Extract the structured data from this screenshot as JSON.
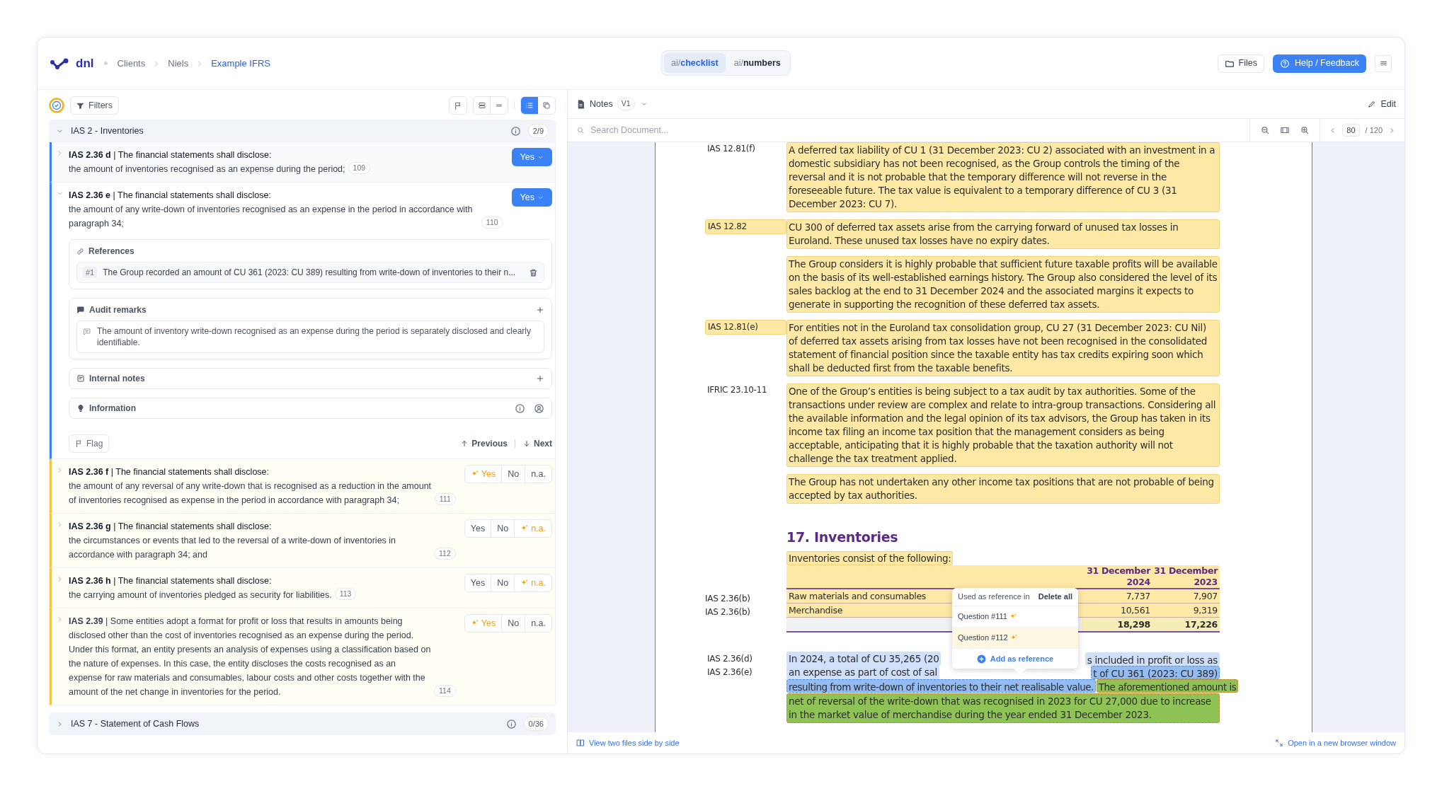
{
  "header": {
    "logo": "dnl",
    "breadcrumbs": [
      {
        "label": "Clients",
        "current": false
      },
      {
        "label": "Niels",
        "current": false
      },
      {
        "label": "Example IFRS",
        "current": true
      }
    ],
    "mode_tabs": [
      {
        "prefix": "ai/",
        "label": "checklist",
        "selected": true
      },
      {
        "prefix": "ai/",
        "label": "numbers",
        "selected": false
      }
    ],
    "files_button": "Files",
    "help_button": "Help / Feedback"
  },
  "checklist": {
    "filters_button": "Filters",
    "view_modes": [
      {
        "kind": "list",
        "selected": true
      },
      {
        "kind": "cards",
        "selected": false
      }
    ],
    "groups": [
      {
        "title": "IAS 2 - Inventories",
        "count": "2/9",
        "expanded": true,
        "items": [
          {
            "title": "**IAS 2.36 d** | The financial statements shall disclose:",
            "body": "the amount of inventories recognised as an expense during the period;",
            "number": "109",
            "expanded": false,
            "answer": {
              "kind": "confirmed",
              "label": "Yes"
            }
          },
          {
            "title": "**IAS 2.36 e** | The financial statements shall disclose:",
            "body": "the amount of any write-down of inventories recognised as an expense in the period in accordance with paragraph 34;",
            "number": "110",
            "expanded": true,
            "answer": {
              "kind": "confirmed",
              "label": "Yes"
            },
            "details": {
              "references": {
                "title": "References",
                "items": [
                  {
                    "index": "#1",
                    "text": "The Group recorded an amount of CU 361 (2023: CU 389) resulting from write-down of inventories to their n..."
                  }
                ]
              },
              "audit_remarks": {
                "title": "Audit remarks",
                "items": [
                  "The amount of inventory write-down recognised as an expense during the period is separately disclosed and clearly identifiable."
                ]
              },
              "internal_notes": {
                "title": "Internal notes"
              },
              "information": {
                "title": "Information"
              },
              "flag_button": "Flag",
              "previous_button": "Previous",
              "next_button": "Next"
            }
          },
          {
            "title": "**IAS 2.36 f** | The financial statements shall disclose:",
            "body": "the amount of any reversal of any write-down that is recognised as a reduction in the amount of inventories recognised as expense in the period in accordance with paragraph 34;",
            "number": "111",
            "expanded": false,
            "answer": {
              "kind": "suggested",
              "options": [
                {
                  "label": "Yes",
                  "suggested": true
                },
                {
                  "label": "No",
                  "suggested": false
                },
                {
                  "label": "n.a.",
                  "suggested": false
                }
              ]
            }
          },
          {
            "title": "**IAS 2.36 g** | The financial statements shall disclose:",
            "body": "the circumstances or events that led to the reversal of a write-down of inventories in accordance with paragraph 34; and",
            "number": "112",
            "expanded": false,
            "answer": {
              "kind": "suggested",
              "options": [
                {
                  "label": "Yes",
                  "suggested": false
                },
                {
                  "label": "No",
                  "suggested": false
                },
                {
                  "label": "n.a.",
                  "suggested": true
                }
              ]
            }
          },
          {
            "title": "**IAS 2.36 h** | The financial statements shall disclose:",
            "body": "the carrying amount of inventories pledged as security for liabilities.",
            "number": "113",
            "expanded": false,
            "answer": {
              "kind": "suggested",
              "options": [
                {
                  "label": "Yes",
                  "suggested": false
                },
                {
                  "label": "No",
                  "suggested": false
                },
                {
                  "label": "n.a.",
                  "suggested": true
                }
              ]
            }
          },
          {
            "title": "**IAS 2.39** | Some entities adopt a format for profit or loss that results in amounts being disclosed other than the cost of inventories recognised as an expense during the period. Under this format, an entity presents an analysis of expenses using a classification based on the nature of expenses. In this case, the entity discloses the costs recognised as an expense for raw materials and consumables, labour costs and other costs together with the amount of the net change in inventories for the period.",
            "number": "114",
            "expanded": false,
            "answer": {
              "kind": "suggested",
              "options": [
                {
                  "label": "Yes",
                  "suggested": true
                },
                {
                  "label": "No",
                  "suggested": false
                },
                {
                  "label": "n.a.",
                  "suggested": false
                }
              ]
            }
          }
        ]
      },
      {
        "title": "IAS 7 - Statement of Cash Flows",
        "count": "0/36",
        "expanded": false
      }
    ]
  },
  "viewer": {
    "document": "Notes",
    "version": "V1",
    "edit_button": "Edit",
    "search": {
      "placeholder": "Search Document..."
    },
    "page": "80",
    "page_total": "/ 120",
    "blocks": [
      {
        "refs": [
          "IAS 12.81(f)"
        ],
        "ref_highlighted": false,
        "paragraphs": [
          "A deferred tax liability of CU 1 (31 December 2023: CU 2) associated with an investment in a domestic subsidiary has not been recognised, as the Group controls the timing of the reversal and it is not probable that the temporary difference will not reverse in the foreseeable future. The tax value is equivalent to a temporary difference of CU 3 (31 December 2023: CU 7)."
        ]
      },
      {
        "refs": [
          "IAS 12.82"
        ],
        "ref_highlighted": true,
        "paragraphs": [
          "CU 300 of deferred tax assets arise from the carrying forward of unused tax losses in Euroland. These unused tax losses have no expiry dates.",
          "The Group considers it is highly probable that sufficient future taxable profits will be available on the basis of its well-established earnings history. The Group also considered the level of its sales backlog at the end to 31 December 2024 and the associated margins it expects to generate in supporting the recognition of these deferred tax assets."
        ]
      },
      {
        "refs": [
          "IAS 12.81(e)"
        ],
        "ref_highlighted": true,
        "paragraphs": [
          "For entities not in the Euroland tax consolidation group, CU 27 (31 December 2023: CU Nil) of deferred tax assets arising from tax losses have not been recognised in the consolidated statement of financial position since the taxable entity has tax credits expiring soon which shall be deducted first from the taxable benefits."
        ]
      },
      {
        "refs": [
          "IFRIC 23.10-11"
        ],
        "ref_highlighted": false,
        "paragraphs": [
          "One of the Group’s entities is being subject to a tax audit by tax authorities. Some of the transactions under review are complex and relate to intra-group transactions. Considering all the available information and the legal opinion of its tax advisors, the Group has taken in its income tax filing an income tax position that the management considers as being acceptable, anticipating that it is highly probable that the taxation authority will not challenge the tax treatment applied.",
          "The Group has not undertaken any other income tax positions that are not probable of being accepted by tax authorities."
        ]
      }
    ],
    "heading": "17. Inventories",
    "table_intro": "Inventories consist of the following:",
    "table": {
      "columns": [
        "31 December 2024",
        "31 December 2023"
      ],
      "rows": [
        {
          "ref": "IAS 2.36(b)",
          "label": "Raw materials and consumables",
          "values": [
            "7,737",
            "7,907"
          ]
        },
        {
          "ref": "IAS 2.36(b)",
          "label": "Merchandise",
          "values": [
            "10,561",
            "9,319"
          ]
        }
      ],
      "total": [
        "18,298",
        "17,226"
      ]
    },
    "last_block": {
      "refs": [
        "IAS 2.36(d)",
        "IAS 2.36(e)"
      ],
      "line_1": [
        {
          "text": "In 2024, a total of CU 35,265 (20",
          "kind": "plain"
        },
        {
          "text": "s included in profit or loss as",
          "kind": "plain"
        }
      ],
      "line_2": [
        {
          "text": "an expense as part of cost of sal",
          "kind": "plain"
        },
        {
          "text": "t of CU 361 (2023: CU 389)",
          "kind": "selected"
        }
      ],
      "line_3": [
        {
          "text": "resulting from write-down of inventories to their net realisable value.",
          "kind": "selected"
        },
        {
          "text": "The aforementioned amount is",
          "kind": "linked"
        }
      ],
      "continuation": {
        "text": "net of reversal of the write-down that was recognised in 2023 for CU 27,000 due to increase in the market value of merchandise during the year ended 31 December 2023.",
        "kind": "linked"
      }
    },
    "popup": {
      "title": "Used as reference in",
      "delete_all": "Delete all",
      "questions": [
        {
          "label": "Question #111",
          "hovered": false
        },
        {
          "label": "Question #112",
          "hovered": true
        }
      ],
      "add_button": "Add as reference"
    },
    "footer": {
      "side_by_side": "View two files side by side",
      "open_new": "Open in a new browser window"
    }
  }
}
